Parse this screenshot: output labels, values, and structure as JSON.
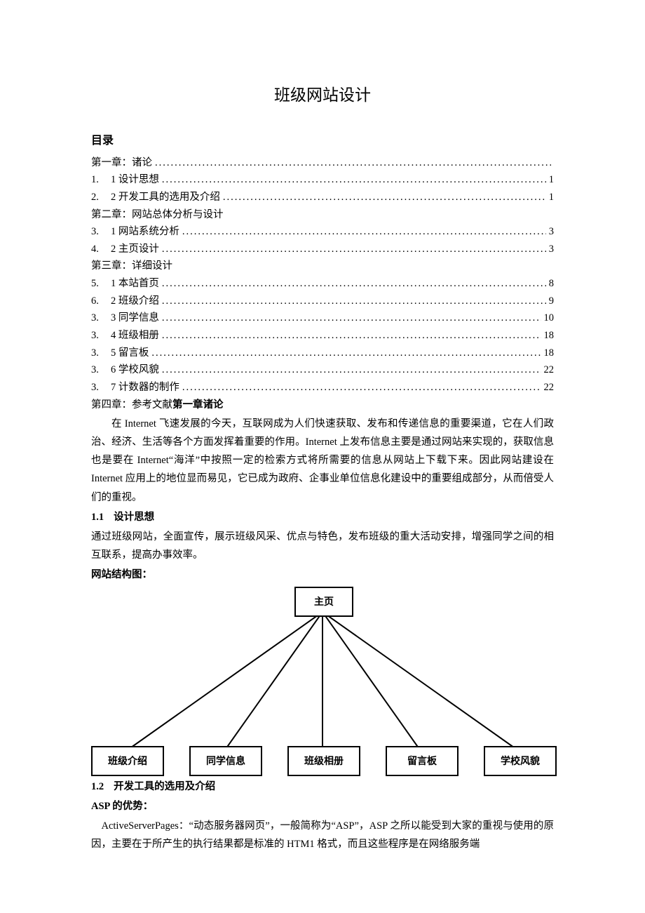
{
  "title": "班级网站设计",
  "toc_heading": "目录",
  "toc": {
    "chapter1": "第一章：诸论",
    "row1_num": "1.",
    "row1_label": "1 设计思想",
    "row1_page": "1",
    "row2_num": "2.",
    "row2_label": "2 开发工具的选用及介绍",
    "row2_page": "1",
    "chapter2": "第二章：网站总体分析与设计",
    "row3_num": "3.",
    "row3_label": "1 网站系统分析",
    "row3_page": "3",
    "row4_num": "4.",
    "row4_label": "2 主页设计",
    "row4_page": "3",
    "chapter3": "第三章：详细设计",
    "row5_num": "5.",
    "row5_label": "1 本站首页",
    "row5_page": "8",
    "row6_num": "6.",
    "row6_label": "2 班级介绍",
    "row6_page": "9",
    "row7_num": "3.",
    "row7_label": "3 同学信息",
    "row7_page": "10",
    "row8_num": "3.",
    "row8_label": "4 班级相册",
    "row8_page": "18",
    "row9_num": "3.",
    "row9_label": "5 留言板",
    "row9_page": "18",
    "row10_num": "3.",
    "row10_label": "6 学校风貌",
    "row10_page": "22",
    "row11_num": "3.",
    "row11_label": "7 计数器的制作",
    "row11_page": "22",
    "chapter4_prefix": "第四章：参考文献",
    "chapter4_bold": "第一章诸论"
  },
  "intro_para": "在 Internet 飞速发展的今天，互联网成为人们快速获取、发布和传递信息的重要渠道，它在人们政治、经济、生活等各个方面发挥着重要的作用。Internet 上发布信息主要是通过网站来实现的，获取信息也是要在 Internet“海洋”中按照一定的检索方式将所需要的信息从网站上下载下来。因此网站建设在 Internet 应用上的地位显而易见，它已成为政府、企事业单位信息化建设中的重要组成部分，从而倍受人们的重视。",
  "h11_num": "1.1",
  "h11_text": "设计思想",
  "p11": "通过班级网站，全面宣传，展示班级风采、优点与特色，发布班级的重大活动安排，增强同学之间的相互联系，提高办事效率。",
  "struct_heading": "网站结构图：",
  "diagram": {
    "top": "主页",
    "nodes": [
      "班级介绍",
      "同学信息",
      "班级相册",
      "留言板",
      "学校风貌"
    ]
  },
  "h12_num": "1.2",
  "h12_text": "开发工具的选用及介绍",
  "asp_heading": "ASP 的优势：",
  "asp_para": "ActiveServerPages：“动态服务器网页”，一般简称为“ASP”，ASP 之所以能受到大家的重视与使用的原因，主要在于所产生的执行结果都是标准的 HTM1 格式，而且这些程序是在网络服务端"
}
